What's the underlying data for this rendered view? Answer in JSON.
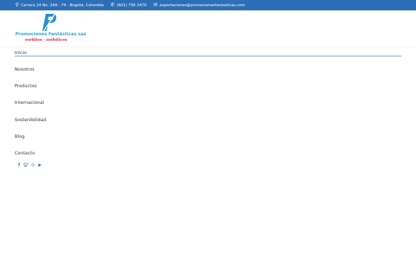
{
  "topbar": {
    "address": "Carrera 24 No. 24A - 74 - Bogotá, Colombia",
    "phone": "(601) 756 2470",
    "email": "exportaciones@promocionesfantasticas.com"
  },
  "logo": {
    "name": "Promociones Fantásticas sas",
    "tagline": "sorbitos · sorbíticos"
  },
  "menu": [
    "Inicio",
    "Nosotros",
    "Productos",
    "Internacional",
    "Sostenibilidad",
    "Blog",
    "Contacto"
  ],
  "social": [
    "facebook-icon",
    "twitter-icon",
    "instagram-icon",
    "youtube-icon"
  ],
  "colors": {
    "topbar": "#2d6fb7",
    "underline": "#a8d3d9"
  }
}
